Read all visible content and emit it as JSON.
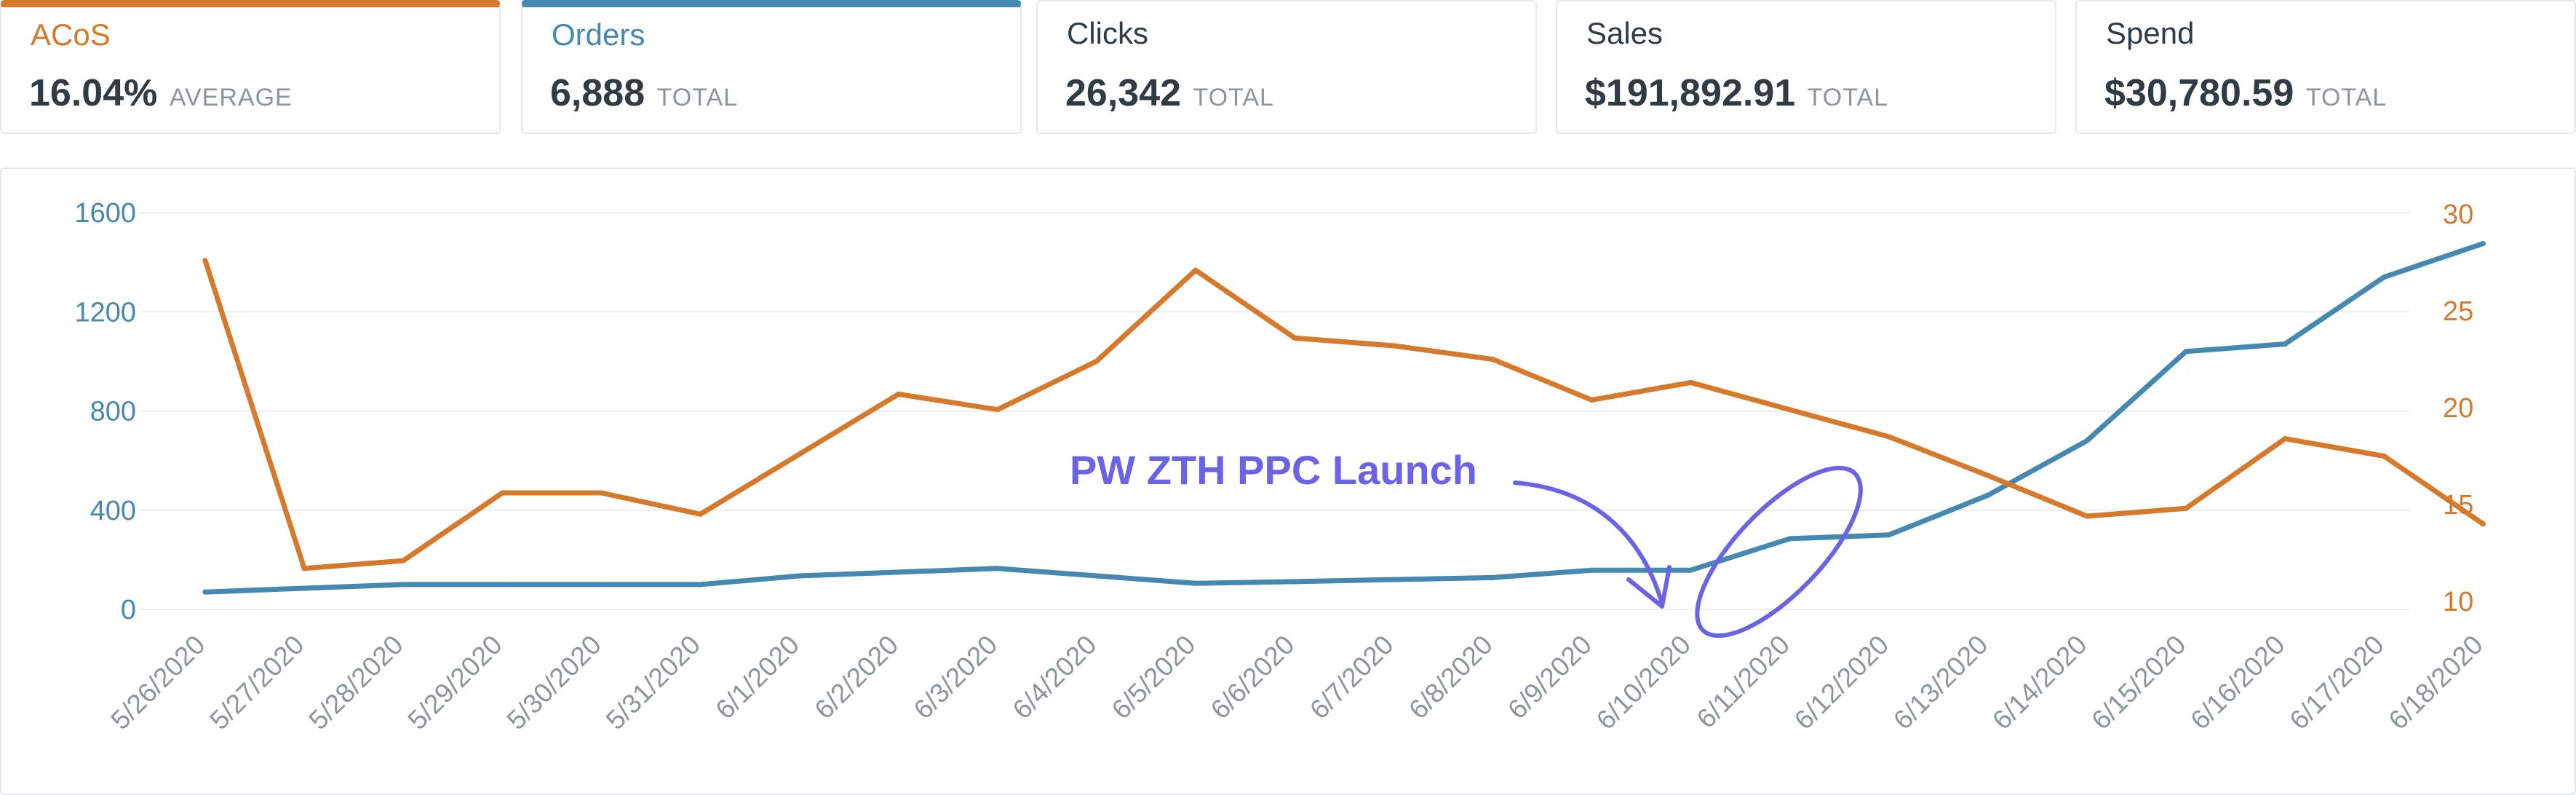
{
  "kpis": [
    {
      "label": "ACoS",
      "value": "16.04%",
      "suffix": "AVERAGE",
      "selected": true,
      "accent": "#d6792b"
    },
    {
      "label": "Orders",
      "value": "6,888",
      "suffix": "TOTAL",
      "selected": true,
      "accent": "#4589b2"
    },
    {
      "label": "Clicks",
      "value": "26,342",
      "suffix": "TOTAL",
      "selected": false
    },
    {
      "label": "Sales",
      "value": "$191,892.91",
      "suffix": "TOTAL",
      "selected": false
    },
    {
      "label": "Spend",
      "value": "$30,780.59",
      "suffix": "TOTAL",
      "selected": false
    }
  ],
  "chart_data": {
    "type": "line",
    "x": [
      "5/26/2020",
      "5/27/2020",
      "5/28/2020",
      "5/29/2020",
      "5/30/2020",
      "5/31/2020",
      "6/1/2020",
      "6/2/2020",
      "6/3/2020",
      "6/4/2020",
      "6/5/2020",
      "6/6/2020",
      "6/7/2020",
      "6/8/2020",
      "6/9/2020",
      "6/10/2020",
      "6/11/2020",
      "6/12/2020",
      "6/13/2020",
      "6/14/2020",
      "6/15/2020",
      "6/16/2020",
      "6/17/2020",
      "6/18/2020"
    ],
    "series": [
      {
        "key": "orders",
        "axis": "left",
        "color": "#4589b2",
        "values": [
          70,
          85,
          100,
          100,
          100,
          100,
          135,
          150,
          165,
          135,
          105,
          112,
          120,
          128,
          158,
          158,
          285,
          300,
          460,
          680,
          1040,
          1070,
          1340,
          1475
        ]
      },
      {
        "key": "acos",
        "axis": "right",
        "color": "#d6792b",
        "values": [
          27.6,
          11.7,
          12.1,
          15.6,
          15.6,
          14.5,
          17.6,
          20.7,
          19.9,
          22.4,
          27.1,
          23.6,
          23.2,
          22.5,
          20.4,
          21.3,
          19.9,
          18.5,
          16.5,
          14.4,
          14.8,
          18.4,
          17.5,
          14.0
        ]
      }
    ],
    "y_left": {
      "ticks": [
        0,
        400,
        800,
        1200,
        1600
      ],
      "range": [
        0,
        1600
      ],
      "color": "#4589b2"
    },
    "y_right": {
      "ticks": [
        10,
        15,
        20,
        25,
        30
      ],
      "range": [
        10,
        30
      ],
      "color": "#d6792b"
    },
    "grid": true,
    "annotation": {
      "text": "PW ZTH PPC Launch",
      "target": "6/11/2020",
      "color": "#6b63e6"
    }
  }
}
